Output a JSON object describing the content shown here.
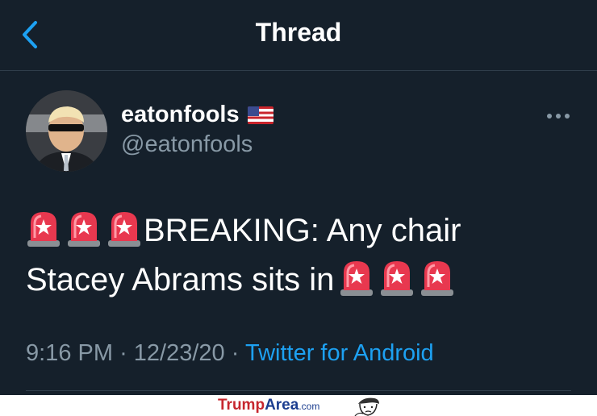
{
  "header": {
    "title": "Thread",
    "back_icon": "chevron-left-icon"
  },
  "tweet": {
    "display_name": "eatonfools",
    "flag_icon": "us-flag-icon",
    "handle": "@eatonfools",
    "more_icon": "more-horizontal-icon",
    "siren_icon": "police-light-emoji",
    "text_line1": "BREAKING: Any chair",
    "text_line2": "Stacey Abrams sits in",
    "time": "9:16 PM",
    "separator": "·",
    "date": "12/23/20",
    "source": "Twitter for Android"
  },
  "watermark": {
    "part1": "Trump",
    "part2": "Area",
    "part3": ".com"
  },
  "colors": {
    "background": "#15202b",
    "accent": "#1da1f2",
    "secondary_text": "#8899a6",
    "divider": "#2f3d4a"
  }
}
